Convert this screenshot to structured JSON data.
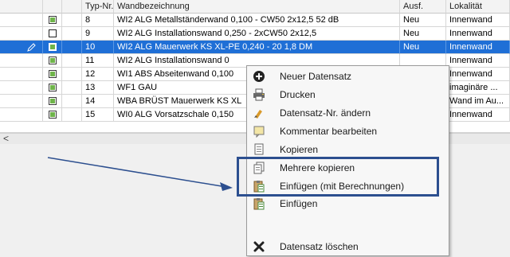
{
  "table": {
    "headers": {
      "typ": "Typ-Nr.",
      "name": "Wandbezeichnung",
      "ausf": "Ausf.",
      "lok": "Lokalität"
    },
    "rows": [
      {
        "typ": "8",
        "name": "WI2 ALG Metallständerwand 0,100 - CW50 2x12,5 52 dB",
        "ausf": "Neu",
        "lok": "Innenwand",
        "checked": true
      },
      {
        "typ": "9",
        "name": "WI2 ALG Installationswand 0,250 - 2xCW50 2x12,5",
        "ausf": "Neu",
        "lok": "Innenwand",
        "checked": false
      },
      {
        "typ": "10",
        "name": "WI2 ALG Mauerwerk KS XL-PE 0,240 - 20 1,8 DM",
        "ausf": "Neu",
        "lok": "Innenwand",
        "checked": true,
        "selected": true
      },
      {
        "typ": "11",
        "name": "WI2 ALG Installationswand 0",
        "ausf": "",
        "lok": "Innenwand",
        "checked": true
      },
      {
        "typ": "12",
        "name": "WI1 ABS Abseitenwand 0,100",
        "ausf": "",
        "lok": "Innenwand",
        "checked": true
      },
      {
        "typ": "13",
        "name": "WF1 GAU",
        "ausf": "",
        "lok": "imaginäre ...",
        "checked": true
      },
      {
        "typ": "14",
        "name": "WBA BRÜST Mauerwerk KS XL",
        "ausf": "",
        "lok": "Wand im Au...",
        "checked": true
      },
      {
        "typ": "15",
        "name": "WI0 ALG Vorsatzschale 0,150",
        "ausf": "",
        "lok": "Innenwand",
        "checked": true
      }
    ]
  },
  "scroll": {
    "left_arrow": "<"
  },
  "context_menu": {
    "items": {
      "new": {
        "label": "Neuer Datensatz",
        "icon": "plus-circle-icon"
      },
      "print": {
        "label": "Drucken",
        "icon": "printer-icon"
      },
      "renumber": {
        "label": "Datensatz-Nr. ändern",
        "icon": "renumber-icon"
      },
      "comment": {
        "label": "Kommentar bearbeiten",
        "icon": "comment-icon"
      },
      "copy": {
        "label": "Kopieren",
        "icon": "copy-icon"
      },
      "copy_multi": {
        "label": "Mehrere kopieren",
        "icon": "copy-multiple-icon"
      },
      "paste_calc": {
        "label": "Einfügen (mit Berechnungen)",
        "icon": "paste-icon"
      },
      "paste": {
        "label": "Einfügen",
        "icon": "paste-icon"
      },
      "delete": {
        "label": "Datensatz löschen",
        "icon": "delete-x-icon"
      }
    }
  },
  "colors": {
    "selection": "#1f6fd6",
    "highlight_box": "#2c4f8f",
    "checkbox_green": "#6fb44a"
  }
}
